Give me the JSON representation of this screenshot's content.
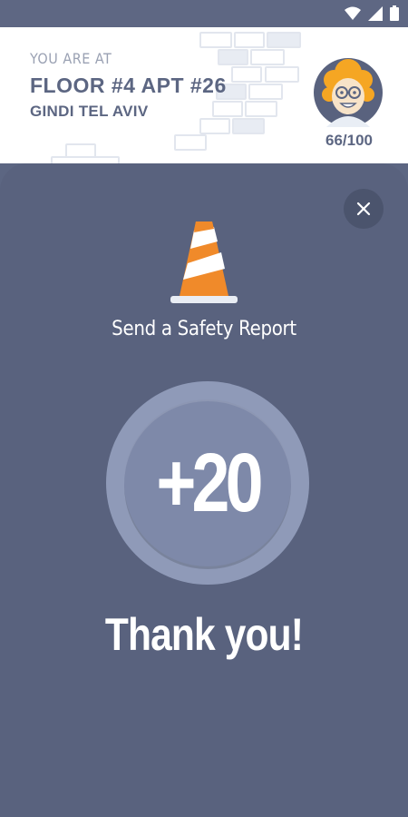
{
  "statusbar": {
    "icons": [
      "wifi-icon",
      "signal-icon",
      "battery-icon"
    ]
  },
  "header": {
    "location_label": "YOU ARE AT",
    "location_main": "FLOOR #4 APT #26",
    "location_sub": "GINDI TEL AVIV",
    "score": "66/100"
  },
  "modal": {
    "close_icon": "close-icon",
    "report_label": "Send a Safety Report",
    "points": "+20",
    "thanks": "Thank you!"
  },
  "colors": {
    "header_bg": "#ffffff",
    "sheet_bg": "#59627e",
    "text_primary": "#5c6682",
    "cone_orange": "#f08a2a",
    "medal": "#8f9ab8"
  }
}
